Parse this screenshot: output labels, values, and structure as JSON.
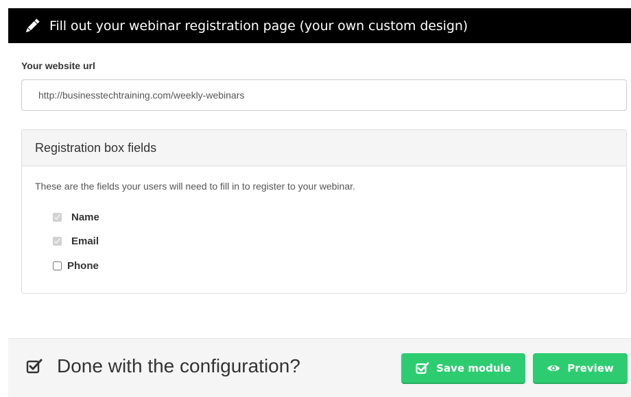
{
  "header": {
    "icon": "pencil-icon",
    "title": "Fill out your webinar registration page (your own custom design)"
  },
  "url_section": {
    "label": "Your website url",
    "value": "http://businesstechtraining.com/weekly-webinars"
  },
  "registration_panel": {
    "title": "Registration box fields",
    "description": "These are the fields your users will need to fill in to register to your webinar.",
    "fields": [
      {
        "label": "Name",
        "checked": true,
        "disabled": true
      },
      {
        "label": "Email",
        "checked": true,
        "disabled": true
      },
      {
        "label": "Phone",
        "checked": false,
        "disabled": false
      }
    ]
  },
  "footer": {
    "icon": "checked-square-icon",
    "question": "Done with the configuration?",
    "save_label": "Save module",
    "save_icon": "checked-square-icon",
    "preview_label": "Preview",
    "preview_icon": "eye-icon"
  },
  "colors": {
    "header_bg": "#000000",
    "button_green": "#2ecc71",
    "panel_heading_bg": "#f5f5f5"
  }
}
